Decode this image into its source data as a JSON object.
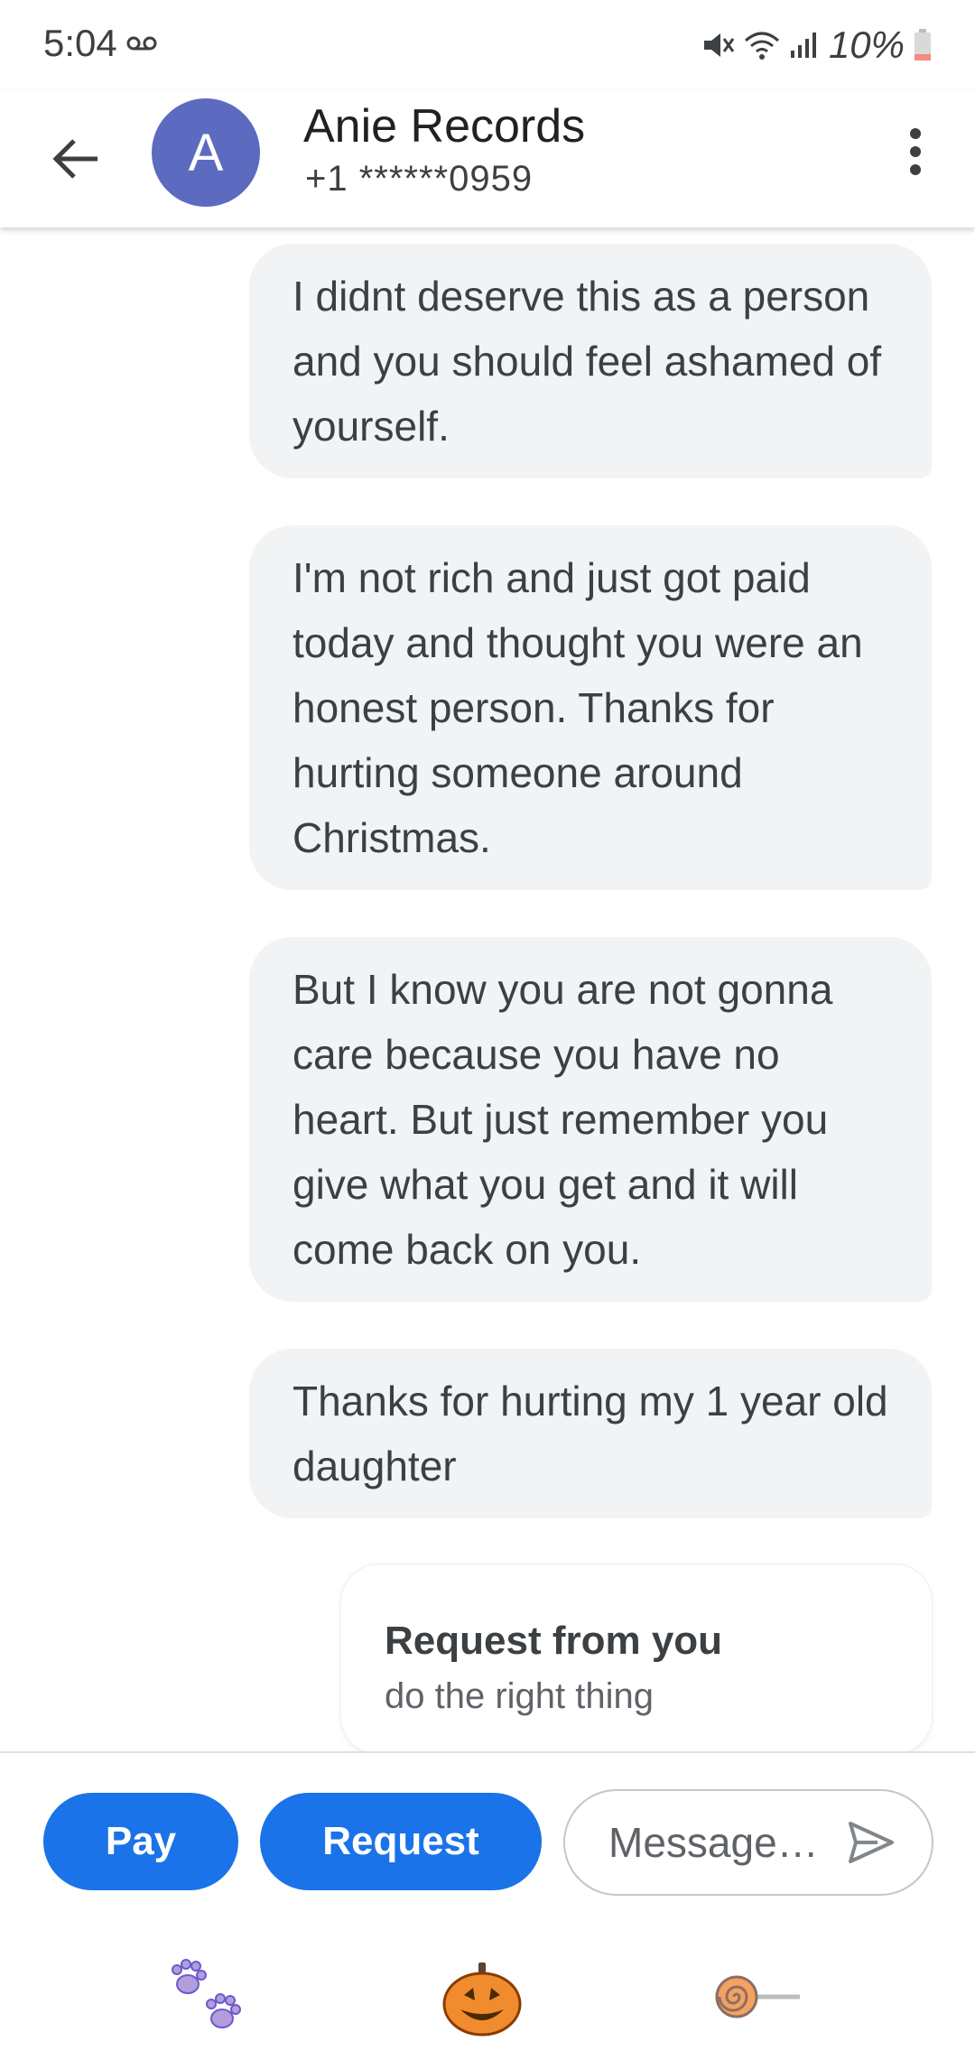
{
  "status_bar": {
    "time": "5:04",
    "voicemail_icon": "voicemail-icon",
    "mute_icon": "vibrate-mute-icon",
    "wifi_icon": "wifi-icon",
    "signal_icon": "cell-signal-icon",
    "battery_text": "10%",
    "battery_icon": "battery-low-icon"
  },
  "header": {
    "back_icon": "arrow-back-icon",
    "avatar_letter": "A",
    "avatar_color": "#5c6bc0",
    "contact_name": "Anie Records",
    "contact_phone": "+1 ******0959",
    "more_icon": "more-vert-icon"
  },
  "messages": [
    {
      "text": "I didnt deserve this as a person and you should feel ashamed of yourself."
    },
    {
      "text": "I'm not rich and just got paid today and thought you were an honest person. Thanks for hurting someone around Christmas."
    },
    {
      "text": "But I know you are not gonna care because you have no heart. But just remember you give what you get and it will come back on you."
    },
    {
      "text": "Thanks for hurting my 1 year old daughter"
    }
  ],
  "request_card": {
    "title": "Request from you",
    "note": "do the right thing"
  },
  "compose": {
    "pay_label": "Pay",
    "request_label": "Request",
    "message_placeholder": "Message…",
    "send_icon": "send-icon",
    "accent_color": "#1a73e8"
  },
  "stickers": [
    "paw-prints-sticker",
    "jack-o-lantern-sticker",
    "lollipop-sticker"
  ]
}
